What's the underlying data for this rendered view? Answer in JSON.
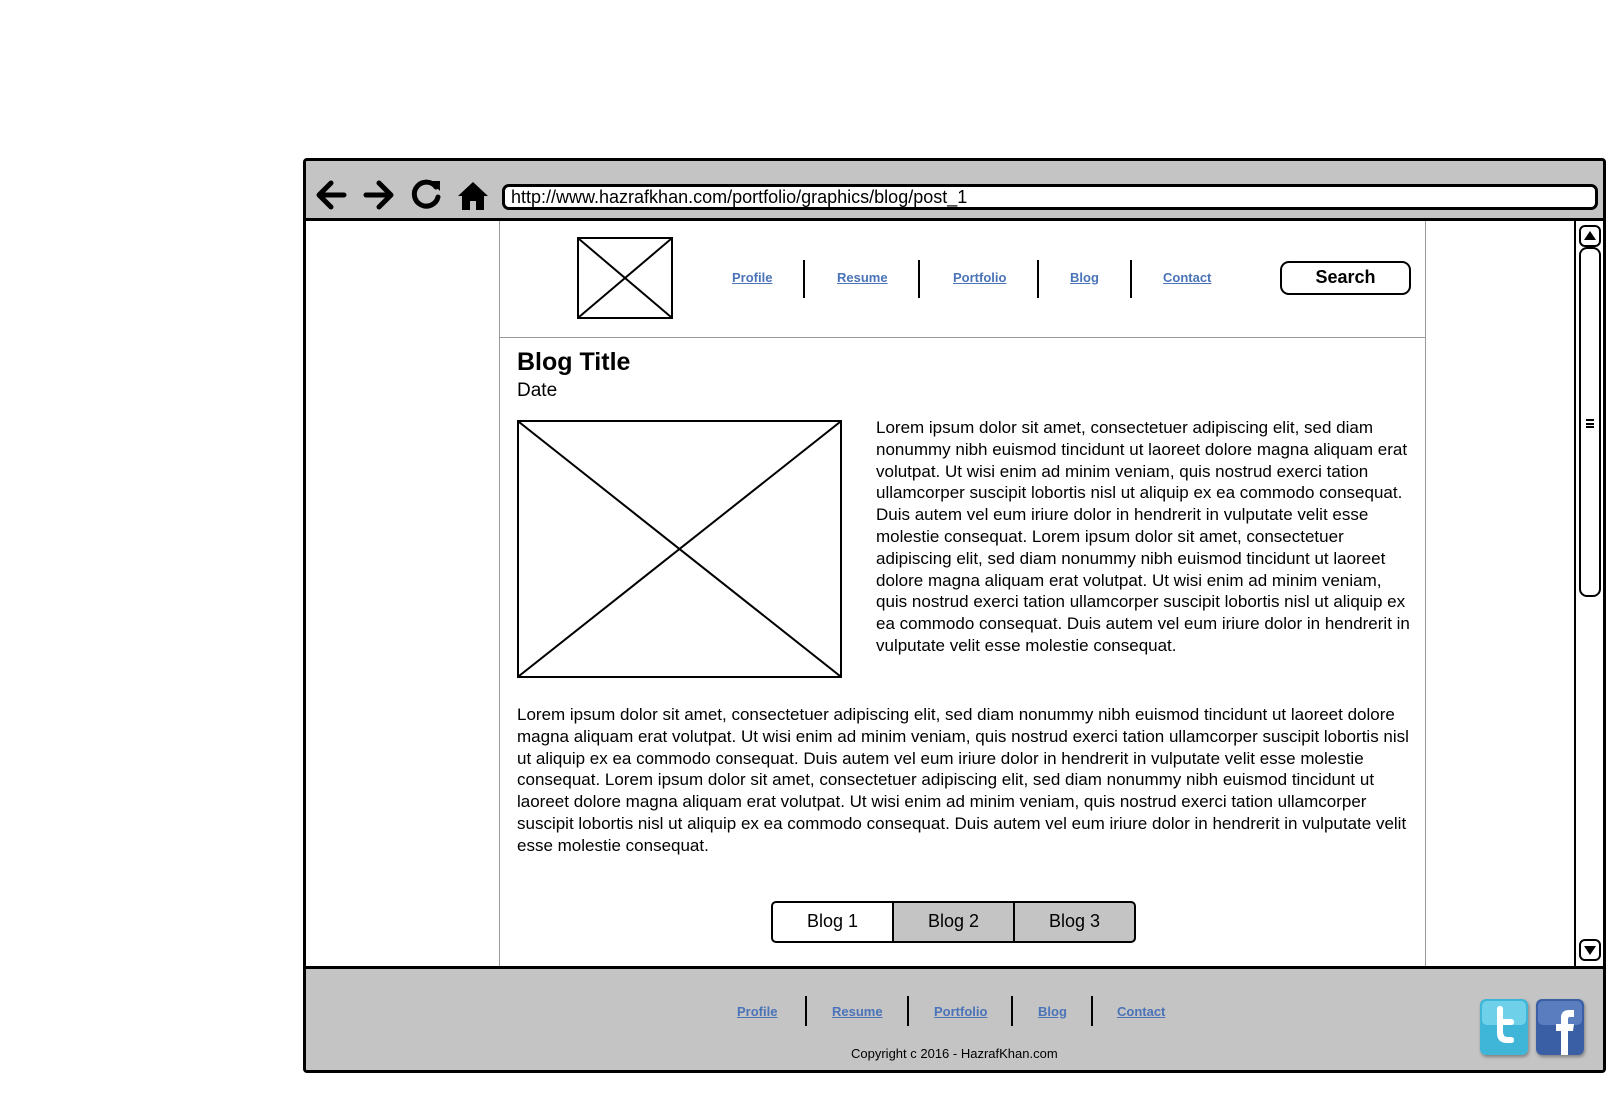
{
  "browser": {
    "url": "http://www.hazrafkhan.com/portfolio/graphics/blog/post_1"
  },
  "nav": {
    "items": [
      {
        "label": "Profile"
      },
      {
        "label": "Resume"
      },
      {
        "label": "Portfolio"
      },
      {
        "label": "Blog"
      },
      {
        "label": "Contact"
      }
    ],
    "search_label": "Search"
  },
  "post": {
    "title": "Blog Title",
    "date": "Date",
    "paragraph_side": "Lorem ipsum dolor sit amet, consectetuer adipiscing elit, sed diam nonummy nibh euismod tincidunt ut laoreet dolore magna aliquam erat volutpat. Ut wisi enim ad minim veniam, quis nostrud exerci tation ullamcorper suscipit lobortis nisl ut aliquip ex ea commodo consequat. Duis autem vel eum iriure dolor in hendrerit in vulputate velit esse molestie consequat. Lorem ipsum dolor sit amet, consectetuer adipiscing elit, sed diam nonummy nibh euismod tincidunt ut laoreet dolore magna aliquam erat volutpat. Ut wisi enim ad minim veniam, quis nostrud exerci tation ullamcorper suscipit lobortis nisl ut aliquip ex ea commodo consequat. Duis autem vel eum iriure dolor in hendrerit in vulputate velit esse molestie consequat.",
    "paragraph_full": "Lorem ipsum dolor sit amet, consectetuer adipiscing elit, sed diam nonummy nibh euismod tincidunt ut laoreet dolore magna aliquam erat volutpat. Ut wisi enim ad minim veniam, quis nostrud exerci tation ullamcorper suscipit lobortis nisl ut aliquip ex ea commodo consequat. Duis autem vel eum iriure dolor in hendrerit in vulputate velit esse molestie consequat. Lorem ipsum dolor sit amet, consectetuer adipiscing elit, sed diam nonummy nibh euismod tincidunt ut laoreet dolore magna aliquam erat volutpat. Ut wisi enim ad minim veniam, quis nostrud exerci tation ullamcorper suscipit lobortis nisl ut aliquip ex ea commodo consequat. Duis autem vel eum iriure dolor in hendrerit in vulputate velit esse molestie consequat."
  },
  "tabs": {
    "items": [
      {
        "label": "Blog 1",
        "selected": true
      },
      {
        "label": "Blog 2",
        "selected": false
      },
      {
        "label": "Blog 3",
        "selected": false
      }
    ]
  },
  "footer": {
    "links": [
      {
        "label": "Profile"
      },
      {
        "label": "Resume"
      },
      {
        "label": "Portfolio"
      },
      {
        "label": "Blog"
      },
      {
        "label": "Contact"
      }
    ],
    "copyright": "Copyright c 2016 - HazrafKhan.com",
    "social": [
      "twitter-icon",
      "facebook-icon"
    ]
  },
  "colors": {
    "chrome_gray": "#c4c4c4",
    "link_blue": "#4a73b8",
    "twitter_blue": "#3fb6d8",
    "facebook_blue": "#3b5fa4"
  }
}
